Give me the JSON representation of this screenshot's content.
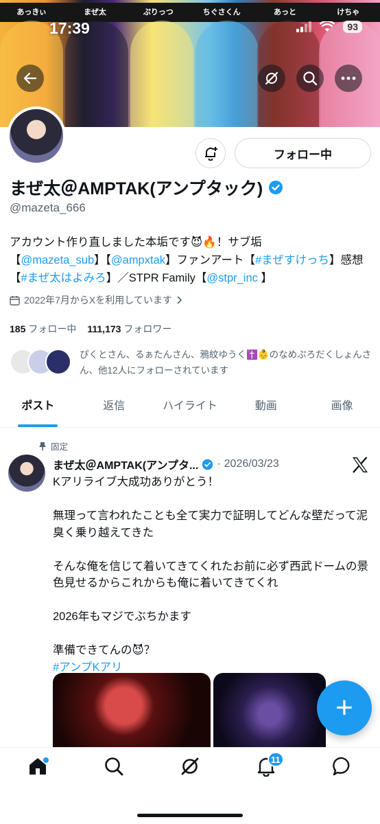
{
  "status_bar": {
    "time": "17:39",
    "battery": "93"
  },
  "banner": {
    "names": [
      "あっきぃ",
      "まぜ太",
      "ぷりっつ",
      "ちぐさくん",
      "あっと",
      "けちゃ"
    ]
  },
  "profile": {
    "follow_button": "フォロー中",
    "display_name": "まぜ太＠AMPTAK(アンプタック)",
    "handle": "@mazeta_666",
    "bio": {
      "line1": "アカウント作り直しました本垢です😈🔥！サブ垢",
      "b1": "【",
      "sub_link": "@mazeta_sub",
      "b2": "】【",
      "amp_link": "@ampxtak",
      "b3": "】ファンアート【",
      "fanart_tag": "#まぜすけっち",
      "b4": "】感想",
      "b5": "【",
      "review_tag": "#まぜ太はよみろ",
      "b6": "】／STPR Family【",
      "stpr_link": "@stpr_inc",
      "b7": " 】"
    },
    "joined": "2022年7月からXを利用しています",
    "following_count": "185",
    "following_label": "フォロー中",
    "followers_count": "111,173",
    "followers_label": "フォロワー",
    "followed_by": "ぴくとさん、るぁたんさん、鴉紋ゆうく✝️👶のなめぷろだくしょんさん、他12人にフォローされています"
  },
  "tabs": [
    "ポスト",
    "返信",
    "ハイライト",
    "動画",
    "画像"
  ],
  "post": {
    "pinned_label": "固定",
    "author": "まぜ太＠AMPTAK(アンプタ...",
    "dot": "·",
    "date": "2026/03/23",
    "paragraphs": [
      "Kアリライブ大成功ありがとう！",
      "無理って言われたことも全て実力で証明してどんな壁だって泥臭く乗り越えてきた",
      "そんな俺を信じて着いてきてくれたお前に必ず西武ドームの景色見せるからこれからも俺に着いてきてくれ",
      "2026年もマジでぶちかます"
    ],
    "last_line": "準備できてんの😈？",
    "hashtag": "#アンプKアリ"
  },
  "fab": "+",
  "bottom_nav": {
    "notification_badge": "11"
  },
  "colors": {
    "accent": "#1d9bf0",
    "text": "#0f1419",
    "secondary": "#536471"
  }
}
